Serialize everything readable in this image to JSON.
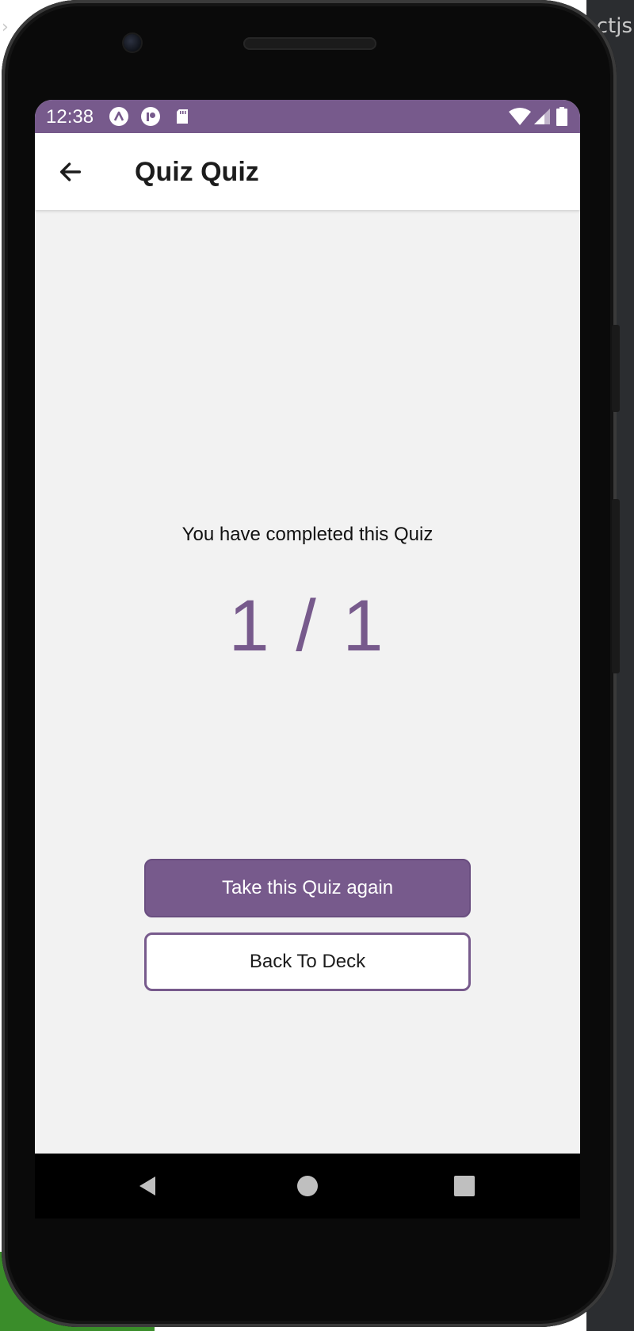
{
  "status_bar": {
    "time": "12:38",
    "color": "#775a8c",
    "left_icons": [
      "app-a-icon",
      "app-p-icon",
      "sd-card-icon"
    ],
    "right_icons": [
      "wifi-icon",
      "cell-signal-icon",
      "battery-icon"
    ]
  },
  "app_bar": {
    "back_icon": "back-arrow-icon",
    "title": "Quiz Quiz"
  },
  "result": {
    "message": "You have completed this Quiz",
    "score": "1 / 1",
    "accent": "#775a8c"
  },
  "actions": {
    "retake_label": "Take this Quiz again",
    "back_label": "Back To Deck"
  },
  "nav_bar": {
    "buttons": [
      "nav-back-icon",
      "nav-home-icon",
      "nav-recents-icon"
    ]
  },
  "background": {
    "right_text": "ctjs"
  }
}
